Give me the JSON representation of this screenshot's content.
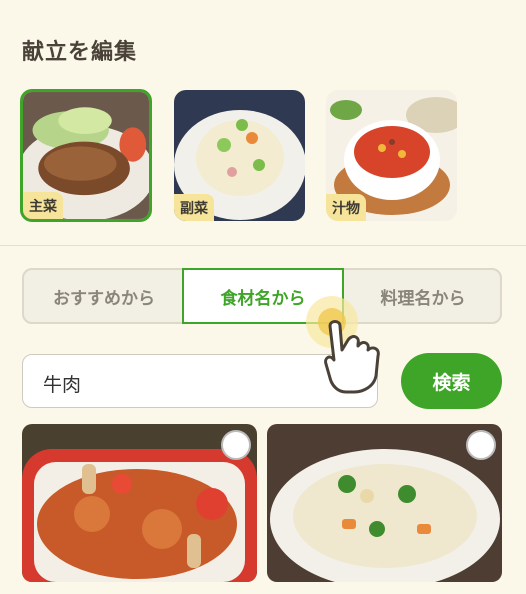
{
  "page": {
    "title": "献立を編集"
  },
  "categories": [
    {
      "label": "主菜",
      "selected": true
    },
    {
      "label": "副菜",
      "selected": false
    },
    {
      "label": "汁物",
      "selected": false
    }
  ],
  "tabs": [
    {
      "label": "おすすめから",
      "active": false
    },
    {
      "label": "食材名から",
      "active": true
    },
    {
      "label": "料理名から",
      "active": false
    }
  ],
  "search": {
    "value": "牛肉",
    "clear_icon": "×",
    "button_label": "検索"
  },
  "colors": {
    "accent": "#3fa528",
    "background": "#fbf8e9",
    "tag": "#f5e49a"
  },
  "icons": [
    "clear-icon",
    "pointer-hand-icon",
    "check-circle-icon"
  ]
}
